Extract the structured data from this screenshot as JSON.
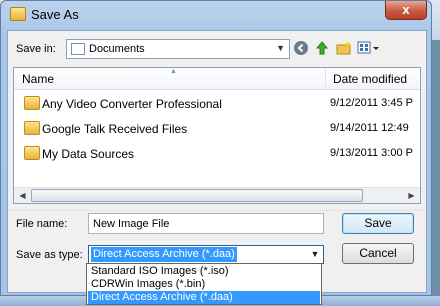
{
  "window": {
    "title": "Save As",
    "close_glyph": "x"
  },
  "save_in": {
    "label": "Save in:",
    "value": "Documents"
  },
  "toolbar": {
    "back_icon": "back-icon",
    "up_icon": "up-folder-icon",
    "new_folder_icon": "new-folder-icon",
    "views_icon": "views-icon"
  },
  "file_list": {
    "columns": {
      "name": "Name",
      "date": "Date modified"
    },
    "rows": [
      {
        "name": "Any Video Converter Professional",
        "date": "9/12/2011 3:45 P"
      },
      {
        "name": "Google Talk Received Files",
        "date": "9/14/2011 12:49"
      },
      {
        "name": "My Data Sources",
        "date": "9/13/2011 3:00 P"
      }
    ]
  },
  "file_name": {
    "label": "File name:",
    "value": "New Image File"
  },
  "save_as_type": {
    "label": "Save as type:",
    "value": "Direct Access Archive (*.daa)",
    "options": [
      "Standard ISO Images (*.iso)",
      "CDRWin Images (*.bin)",
      "Direct Access Archive (*.daa)"
    ],
    "selected_index": 2
  },
  "buttons": {
    "save": "Save",
    "cancel": "Cancel"
  },
  "colors": {
    "selection": "#3399ff",
    "frame": "#a6c3e6"
  }
}
